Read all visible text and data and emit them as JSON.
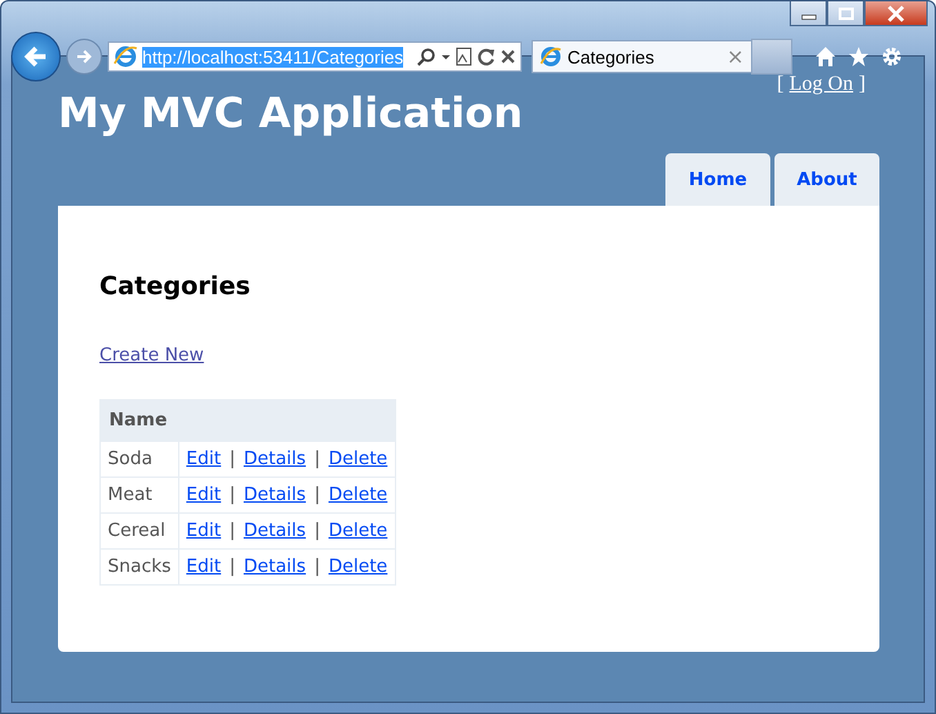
{
  "browser": {
    "address": "http://localhost:53411/Categories",
    "tab_title": "Categories",
    "tab_close": "×"
  },
  "header": {
    "site_title": "My MVC Application",
    "login_open": "[",
    "login_link": "Log On",
    "login_close": "]"
  },
  "menu": [
    {
      "label": "Home"
    },
    {
      "label": "About"
    }
  ],
  "content": {
    "heading": "Categories",
    "create_link": "Create New",
    "table": {
      "columns": [
        "Name"
      ],
      "separator": "|",
      "rows": [
        {
          "name": "Soda",
          "actions": [
            "Edit",
            "Details",
            "Delete"
          ]
        },
        {
          "name": "Meat",
          "actions": [
            "Edit",
            "Details",
            "Delete"
          ]
        },
        {
          "name": "Cereal",
          "actions": [
            "Edit",
            "Details",
            "Delete"
          ]
        },
        {
          "name": "Snacks",
          "actions": [
            "Edit",
            "Details",
            "Delete"
          ]
        }
      ]
    }
  }
}
